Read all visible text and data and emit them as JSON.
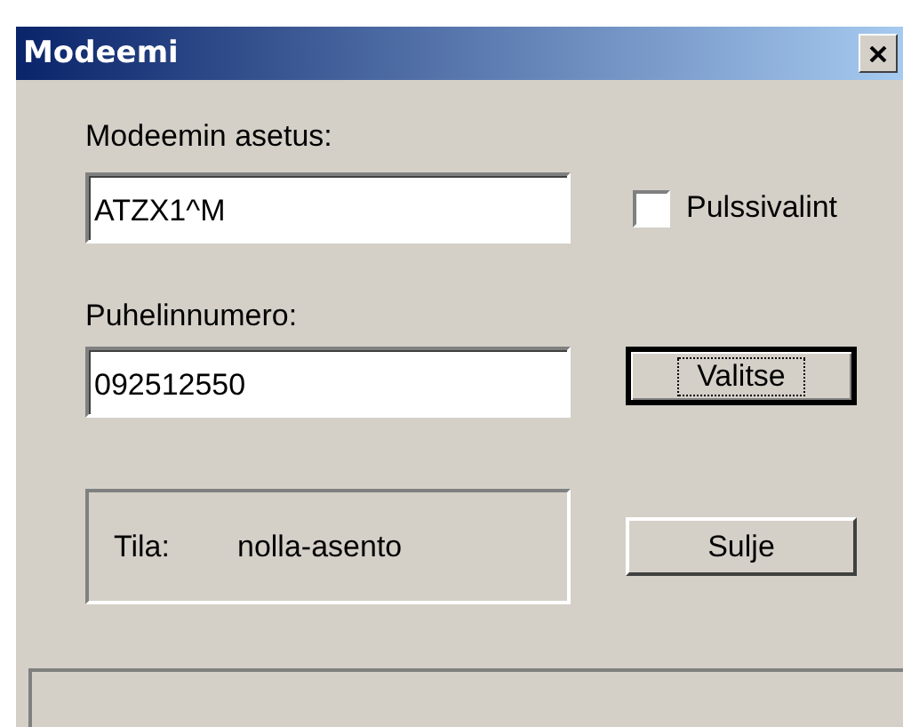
{
  "window": {
    "title": "Modeemi"
  },
  "modem_setting": {
    "label": "Modeemin asetus:",
    "value": "ATZX1^M"
  },
  "pulse_dialing": {
    "label": "Pulssivalint",
    "checked": false
  },
  "phone_number": {
    "label": "Puhelinnumero:",
    "value": "092512550"
  },
  "buttons": [
    {
      "label": "Valitse",
      "focused": true
    },
    {
      "label": "Sulje",
      "focused": false
    }
  ],
  "status": {
    "label": "Tila:",
    "value": "nolla-asento"
  }
}
